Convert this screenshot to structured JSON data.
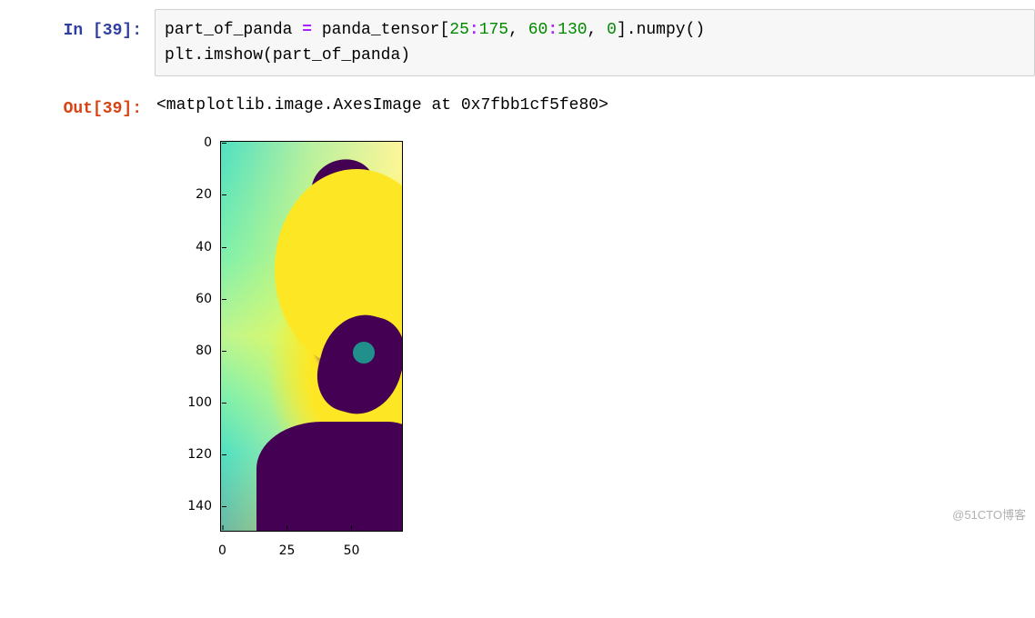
{
  "input": {
    "prompt": "In [39]:",
    "code": {
      "t1": "part_of_panda ",
      "op": "=",
      "t2": " panda_tensor[",
      "n1": "25",
      "c1": ":",
      "n2": "175",
      "comma1": ", ",
      "n3": "60",
      "c2": ":",
      "n4": "130",
      "comma2": ", ",
      "n5": "0",
      "t3": "].numpy()",
      "line2": "plt.imshow(part_of_panda)"
    }
  },
  "output": {
    "prompt": "Out[39]:",
    "text": "<matplotlib.image.AxesImage at 0x7fbb1cf5fe80>"
  },
  "chart_data": {
    "type": "heatmap",
    "title": "",
    "xlabel": "",
    "ylabel": "",
    "x_ticks": [
      0,
      25,
      50
    ],
    "y_ticks": [
      0,
      20,
      40,
      60,
      80,
      100,
      120,
      140
    ],
    "xlim": [
      -0.5,
      69.5
    ],
    "ylim": [
      149.5,
      -0.5
    ],
    "shape": [
      150,
      70
    ],
    "colormap": "viridis",
    "note": "imshow of slice panda_tensor[25:175,60:130,0] (150x70 single-channel array)"
  },
  "watermark": "@51CTO博客"
}
